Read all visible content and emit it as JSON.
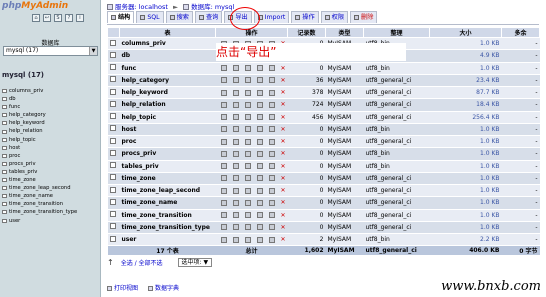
{
  "sidebar": {
    "logo_php": "php",
    "logo_myadmin": "MyAdmin",
    "nav_icons": [
      "home",
      "exit",
      "sql",
      "help",
      "docs"
    ],
    "db_label": "数据库",
    "db_select_value": "mysql (17)",
    "db_title": "mysql (17)",
    "tables": [
      "columns_priv",
      "db",
      "func",
      "help_category",
      "help_keyword",
      "help_relation",
      "help_topic",
      "host",
      "proc",
      "procs_priv",
      "tables_priv",
      "time_zone",
      "time_zone_leap_second",
      "time_zone_name",
      "time_zone_transition",
      "time_zone_transition_type",
      "user"
    ]
  },
  "breadcrumb": {
    "server_label": "服务器: localhost",
    "db_label": "数据库: mysql"
  },
  "tabs": [
    {
      "label": "结构",
      "icon": "structure-icon",
      "active": true
    },
    {
      "label": "SQL",
      "icon": "sql-icon"
    },
    {
      "label": "搜索",
      "icon": "search-icon"
    },
    {
      "label": "查询",
      "icon": "query-icon"
    },
    {
      "label": "导出",
      "icon": "export-icon"
    },
    {
      "label": "Import",
      "icon": "import-icon"
    },
    {
      "label": "操作",
      "icon": "operations-icon"
    },
    {
      "label": "权限",
      "icon": "privileges-icon"
    },
    {
      "label": "删除",
      "icon": "drop-icon",
      "danger": true
    }
  ],
  "table_headers": {
    "table": "表",
    "action": "操作",
    "records": "记录数",
    "type": "类型",
    "collation": "整理",
    "size": "大小",
    "overhead": "多余"
  },
  "rows": [
    {
      "name": "columns_priv",
      "records": "0",
      "type": "MyISAM",
      "collation": "utf8_bin",
      "size": "1.0 KB",
      "overhead": "-"
    },
    {
      "name": "db",
      "records": "2",
      "type": "MyISAM",
      "collation": "utf8_bin",
      "size": "4.9 KB",
      "overhead": "-"
    },
    {
      "name": "func",
      "records": "0",
      "type": "MyISAM",
      "collation": "utf8_bin",
      "size": "1.0 KB",
      "overhead": "-"
    },
    {
      "name": "help_category",
      "records": "36",
      "type": "MyISAM",
      "collation": "utf8_general_ci",
      "size": "23.4 KB",
      "overhead": "-"
    },
    {
      "name": "help_keyword",
      "records": "378",
      "type": "MyISAM",
      "collation": "utf8_general_ci",
      "size": "87.7 KB",
      "overhead": "-"
    },
    {
      "name": "help_relation",
      "records": "724",
      "type": "MyISAM",
      "collation": "utf8_general_ci",
      "size": "18.4 KB",
      "overhead": "-"
    },
    {
      "name": "help_topic",
      "records": "456",
      "type": "MyISAM",
      "collation": "utf8_general_ci",
      "size": "256.4 KB",
      "overhead": "-"
    },
    {
      "name": "host",
      "records": "0",
      "type": "MyISAM",
      "collation": "utf8_bin",
      "size": "1.0 KB",
      "overhead": "-"
    },
    {
      "name": "proc",
      "records": "0",
      "type": "MyISAM",
      "collation": "utf8_general_ci",
      "size": "1.0 KB",
      "overhead": "-"
    },
    {
      "name": "procs_priv",
      "records": "0",
      "type": "MyISAM",
      "collation": "utf8_bin",
      "size": "1.0 KB",
      "overhead": "-"
    },
    {
      "name": "tables_priv",
      "records": "0",
      "type": "MyISAM",
      "collation": "utf8_bin",
      "size": "1.0 KB",
      "overhead": "-"
    },
    {
      "name": "time_zone",
      "records": "0",
      "type": "MyISAM",
      "collation": "utf8_general_ci",
      "size": "1.0 KB",
      "overhead": "-"
    },
    {
      "name": "time_zone_leap_second",
      "records": "0",
      "type": "MyISAM",
      "collation": "utf8_general_ci",
      "size": "1.0 KB",
      "overhead": "-"
    },
    {
      "name": "time_zone_name",
      "records": "0",
      "type": "MyISAM",
      "collation": "utf8_general_ci",
      "size": "1.0 KB",
      "overhead": "-"
    },
    {
      "name": "time_zone_transition",
      "records": "0",
      "type": "MyISAM",
      "collation": "utf8_general_ci",
      "size": "1.0 KB",
      "overhead": "-"
    },
    {
      "name": "time_zone_transition_type",
      "records": "0",
      "type": "MyISAM",
      "collation": "utf8_general_ci",
      "size": "1.0 KB",
      "overhead": "-"
    },
    {
      "name": "user",
      "records": "2",
      "type": "MyISAM",
      "collation": "utf8_bin",
      "size": "2.2 KB",
      "overhead": "-"
    }
  ],
  "footer": {
    "count": "17 个表",
    "total_label": "总计",
    "records": "1,602",
    "type": "MyISAM",
    "collation": "utf8_general_ci",
    "size": "406.0 KB",
    "overhead": "0 字节"
  },
  "annotation": {
    "text": "点击“导出”",
    "color": "#dd0000"
  },
  "bottom": {
    "select_all": "全选 / 全部不选",
    "with_selected": "选中项:",
    "print_view": "打印视图",
    "data_dictionary": "数据字典"
  },
  "watermark": "www.bnxb.com",
  "colors": {
    "sidebar_bg": "#d0dce0",
    "header_bg": "#d0d8e8",
    "row_odd": "#e8ecf4",
    "row_even": "#d7dee9",
    "link": "#0000cc",
    "danger": "#cc0000"
  }
}
